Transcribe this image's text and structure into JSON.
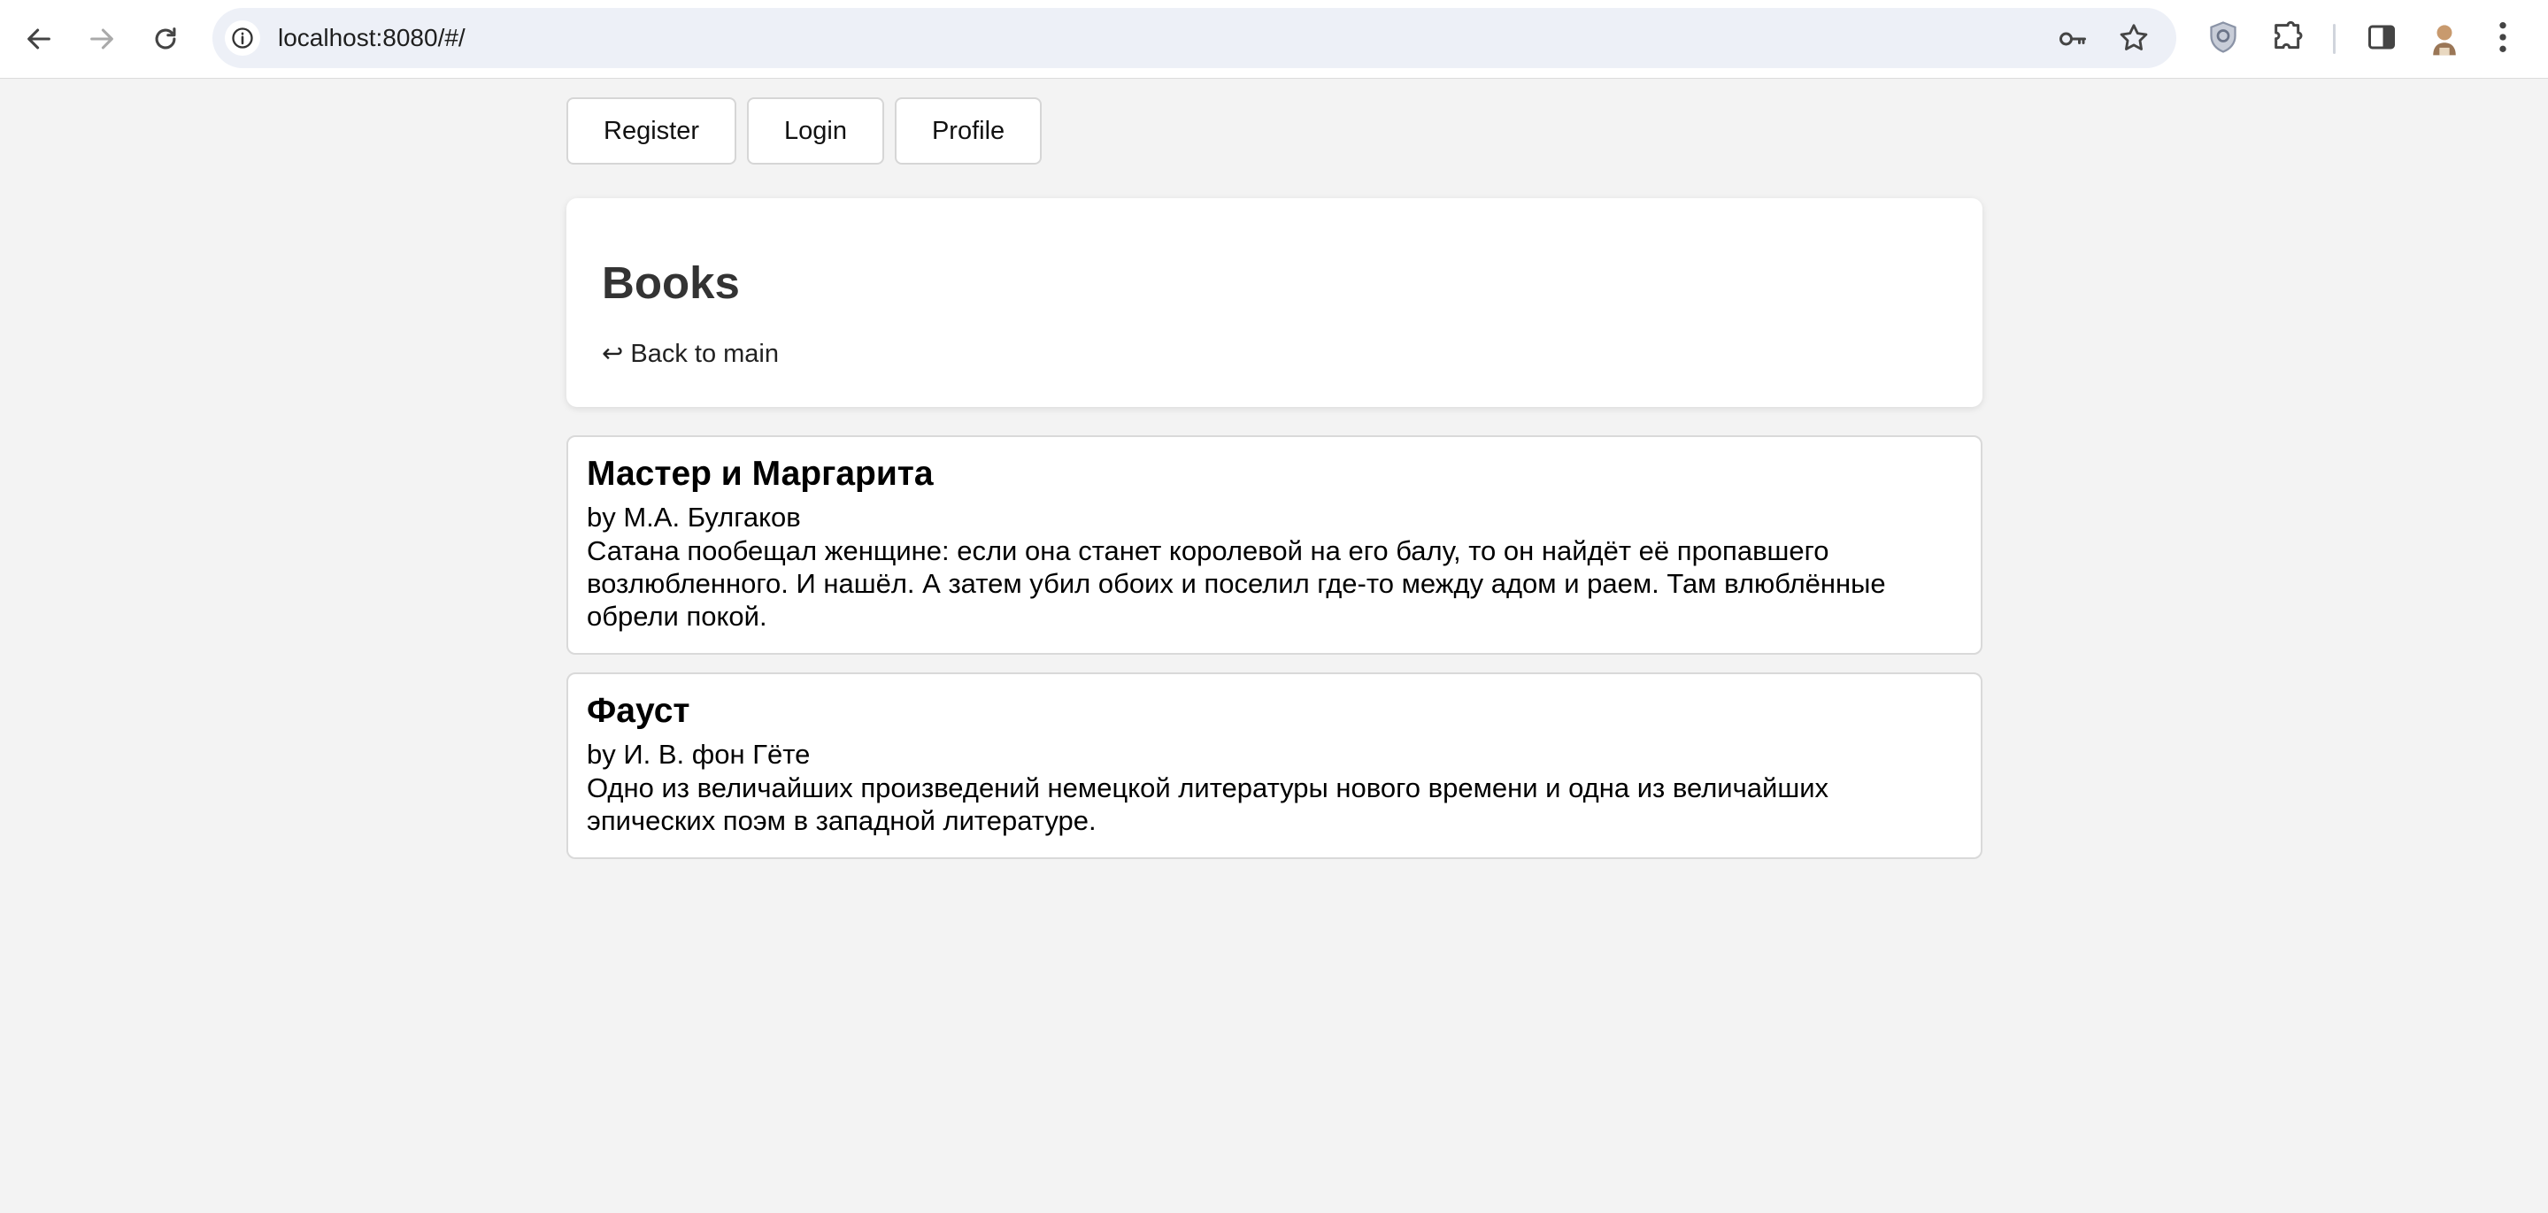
{
  "browser": {
    "url": "localhost:8080/#/"
  },
  "nav": {
    "register": "Register",
    "login": "Login",
    "profile": "Profile"
  },
  "header": {
    "title": "Books",
    "back_arrow": "↩",
    "back_label": "Back to main"
  },
  "books": [
    {
      "title": "Мастер и Маргарита",
      "author": "by М.А. Булгаков",
      "description": "Сатана пообещал женщине: если она станет королевой на его балу, то он найдёт её пропавшего возлюбленного. И нашёл. А затем убил обоих и поселил где-то между адом и раем. Там влюблённые обрели покой."
    },
    {
      "title": "Фауст",
      "author": "by И. В. фон Гёте",
      "description": "Одно из величайших произведений немецкой литературы нового времени и одна из величайших эпических поэм в западной литературе."
    }
  ]
}
